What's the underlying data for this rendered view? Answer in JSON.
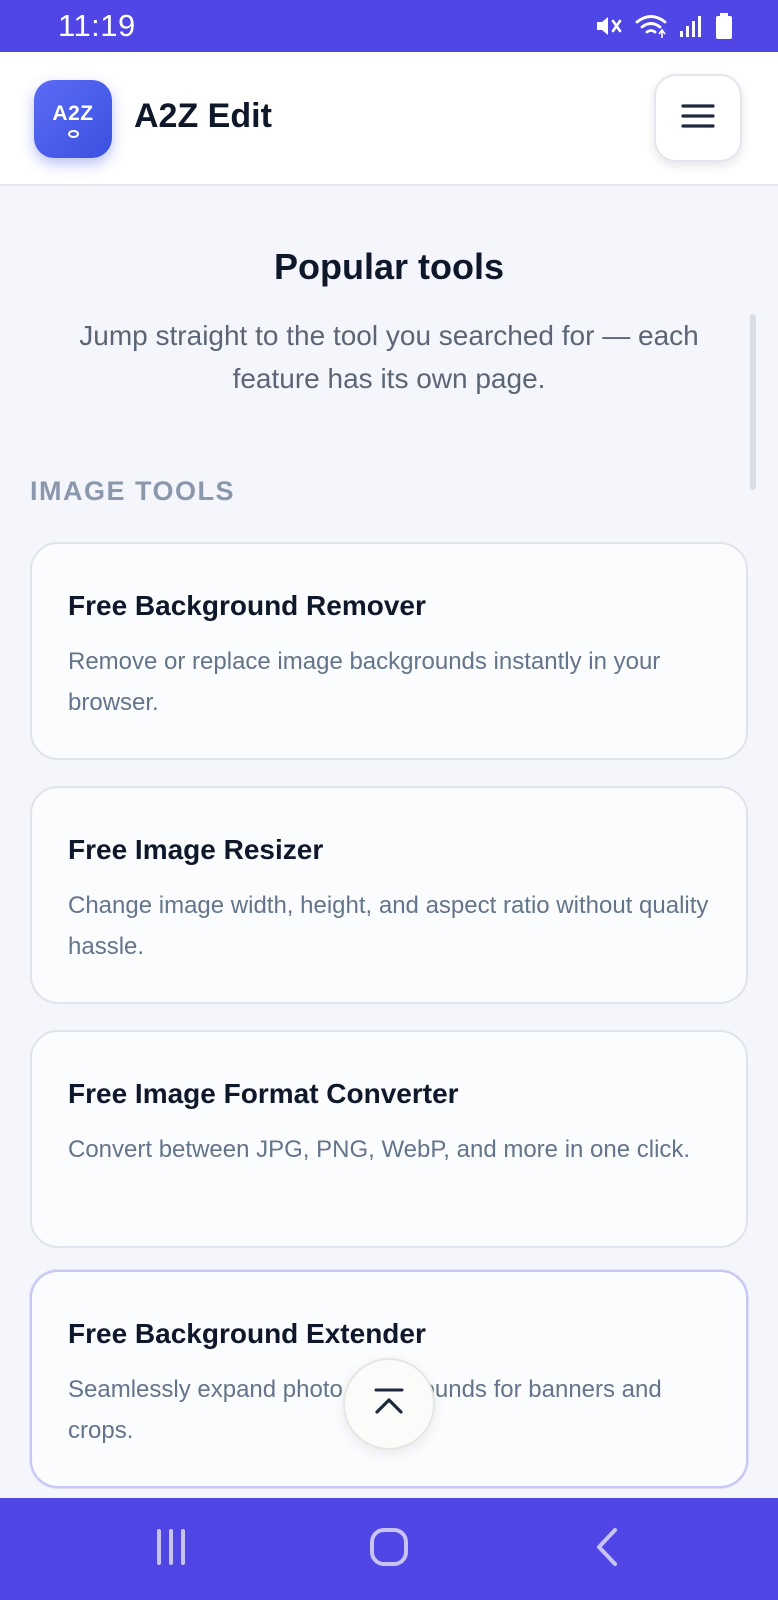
{
  "status_bar": {
    "time": "11:19",
    "icons": [
      "mute-icon",
      "wifi-icon",
      "signal-icon",
      "battery-icon"
    ]
  },
  "header": {
    "logo_text": "A2Z",
    "app_name": "A2Z Edit",
    "menu_icon": "hamburger-menu-icon"
  },
  "intro": {
    "title": "Popular tools",
    "subtitle": "Jump straight to the tool you searched for — each feature has its own page."
  },
  "sections": [
    {
      "label": "IMAGE TOOLS",
      "tools": [
        {
          "name": "Free Background Remover",
          "description": "Remove or replace image backgrounds instantly in your browser."
        },
        {
          "name": "Free Image Resizer",
          "description": "Change image width, height, and aspect ratio without quality hassle."
        },
        {
          "name": "Free Image Format Converter",
          "description": "Convert between JPG, PNG, WebP, and more in one click."
        },
        {
          "name": "Free Background Extender",
          "description": "Seamlessly expand photo backgrounds for banners and crops."
        }
      ]
    }
  ],
  "floating": {
    "back_to_top_icon": "chevron-up-icon"
  },
  "nav_bar": {
    "buttons": [
      "recent-apps-icon",
      "home-icon",
      "back-icon"
    ]
  },
  "colors": {
    "accent": "#4f46e5",
    "logo": "#3b50e0",
    "title_text": "#0f172a",
    "muted_text": "#64748b",
    "group_label": "#8b97ad",
    "page_background": "#f4f6fb"
  }
}
